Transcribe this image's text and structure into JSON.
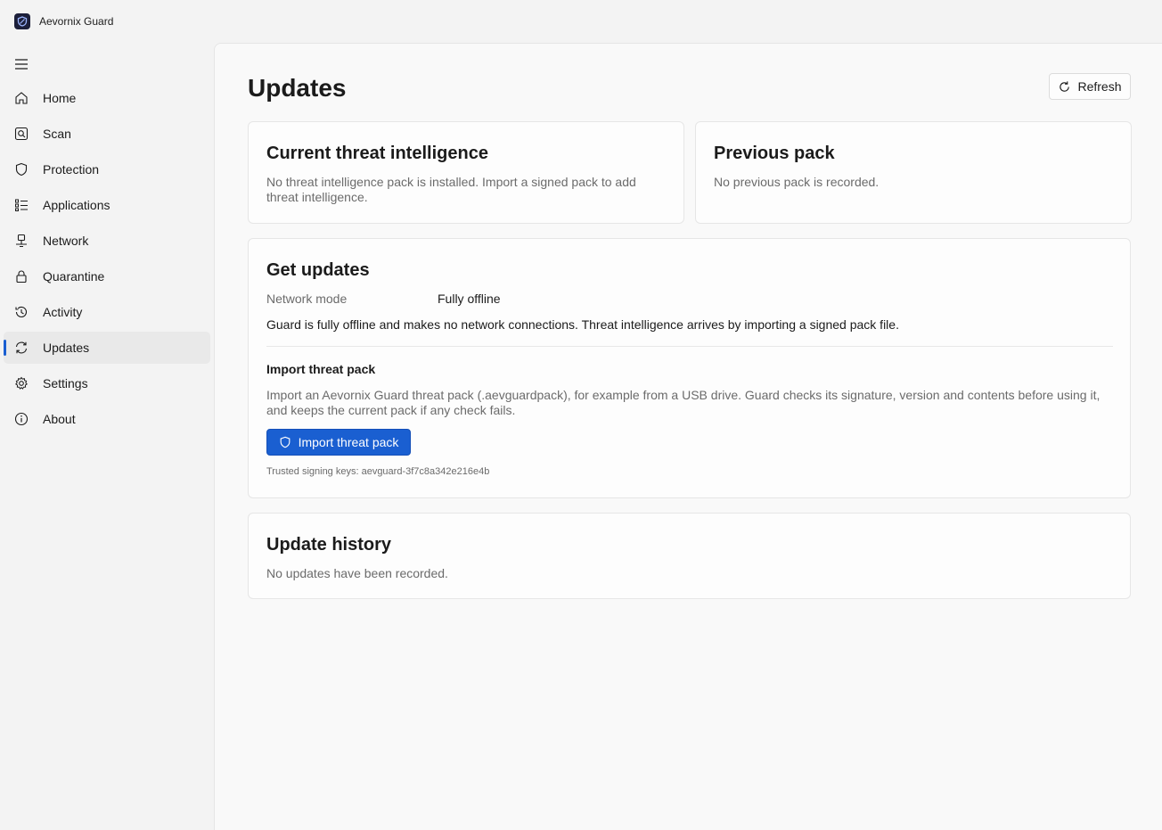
{
  "app": {
    "title": "Aevornix Guard"
  },
  "nav": [
    {
      "label": "Home",
      "icon": "home-icon"
    },
    {
      "label": "Scan",
      "icon": "scan-icon"
    },
    {
      "label": "Protection",
      "icon": "shield-icon"
    },
    {
      "label": "Applications",
      "icon": "list-icon"
    },
    {
      "label": "Network",
      "icon": "network-icon"
    },
    {
      "label": "Quarantine",
      "icon": "lock-icon"
    },
    {
      "label": "Activity",
      "icon": "history-icon"
    },
    {
      "label": "Updates",
      "icon": "sync-icon",
      "active": true
    },
    {
      "label": "Settings",
      "icon": "gear-icon"
    },
    {
      "label": "About",
      "icon": "info-icon"
    }
  ],
  "page": {
    "title": "Updates",
    "refresh_label": "Refresh"
  },
  "current": {
    "title": "Current threat intelligence",
    "text": "No threat intelligence pack is installed. Import a signed pack to add threat intelligence."
  },
  "previous": {
    "title": "Previous pack",
    "text": "No previous pack is recorded."
  },
  "get_updates": {
    "title": "Get updates",
    "mode_label": "Network mode",
    "mode_value": "Fully offline",
    "description": "Guard is fully offline and makes no network connections. Threat intelligence arrives by importing a signed pack file.",
    "import_title": "Import threat pack",
    "import_text": "Import an Aevornix Guard threat pack (.aevguardpack), for example from a USB drive. Guard checks its signature, version and contents before using it, and keeps the current pack if any check fails.",
    "import_button": "Import threat pack",
    "keys": "Trusted signing keys: aevguard-3f7c8a342e216e4b"
  },
  "history": {
    "title": "Update history",
    "text": "No updates have been recorded."
  },
  "colors": {
    "accent": "#1a5fd1",
    "logo": "#1c1f3a"
  }
}
